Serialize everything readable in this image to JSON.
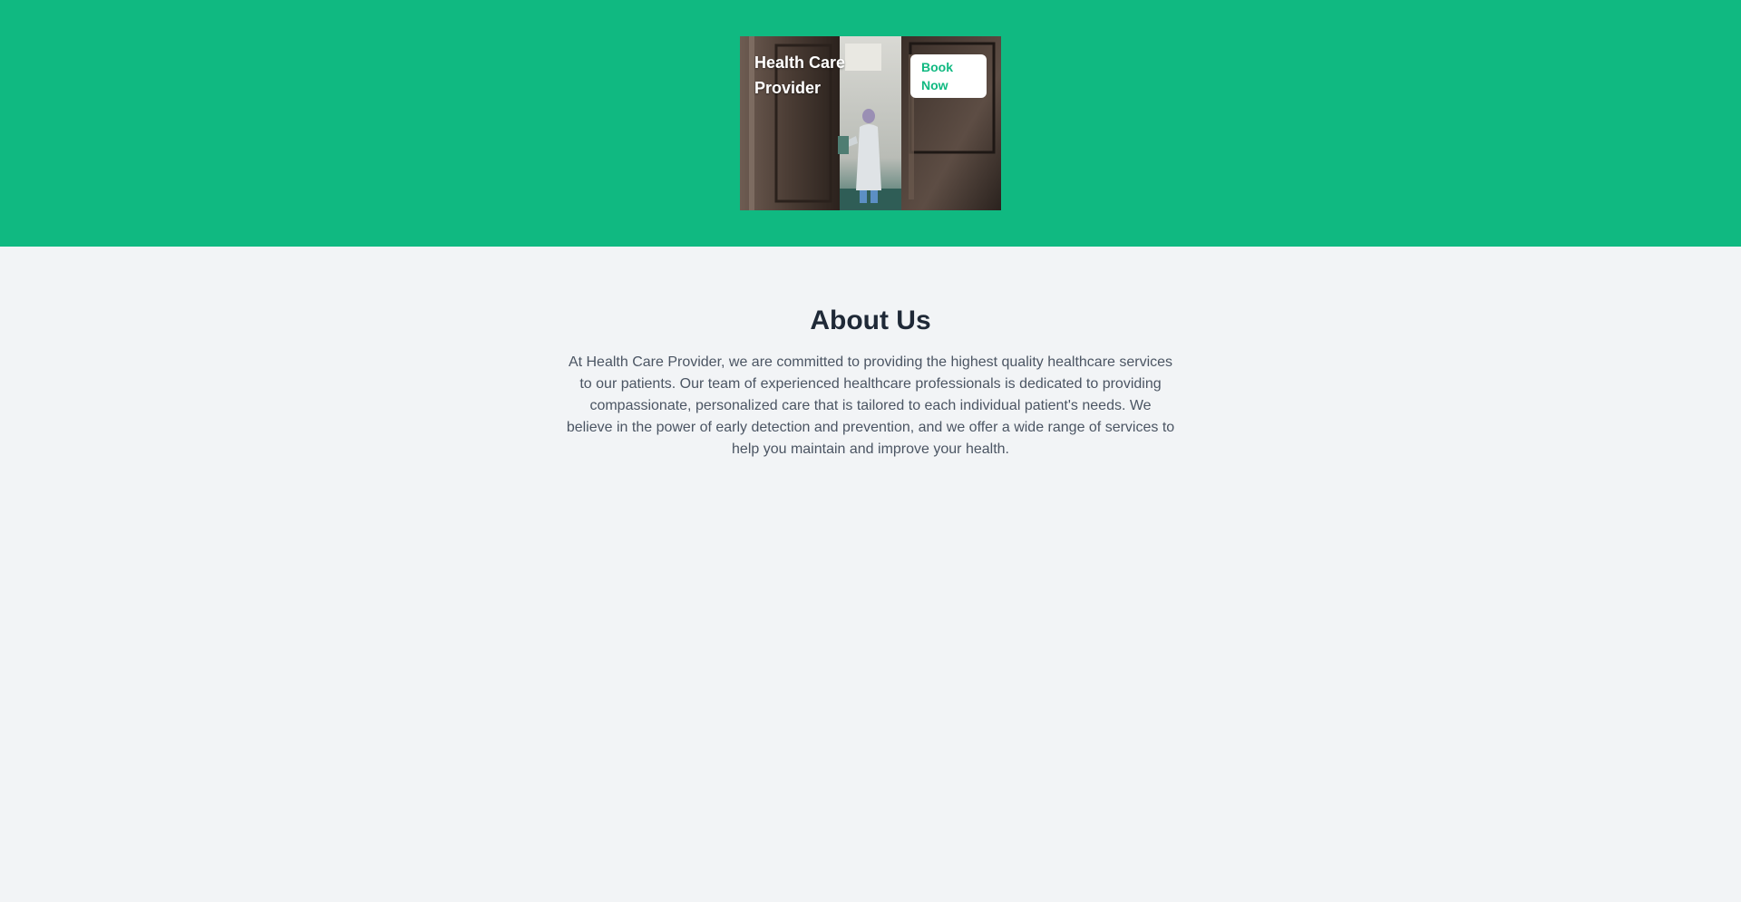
{
  "hero": {
    "brand_line1": "Health Care",
    "brand_line2": "Provider",
    "book_label_line1": "Book",
    "book_label_line2": "Now",
    "photo_icon": "doctor-in-doorway-photo"
  },
  "about": {
    "title": "About Us",
    "body": "At Health Care Provider, we are committed to providing the highest quality healthcare services to our patients. Our team of experienced healthcare professionals is dedicated to providing compassionate, personalized care that is tailored to each individual patient's needs. We believe in the power of early detection and prevention, and we offer a wide range of services to help you maintain and improve your health."
  },
  "colors": {
    "accent": "#10b981",
    "background": "#f2f4f6",
    "heading": "#1f2937",
    "body_text": "#4b5563"
  }
}
